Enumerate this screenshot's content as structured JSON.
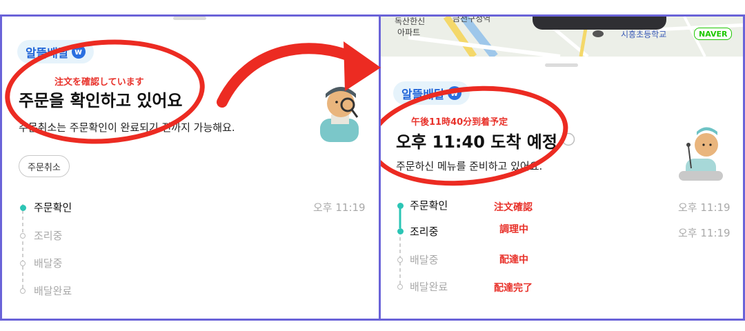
{
  "left": {
    "badge_text": "알뜰배달",
    "badge_icon": "w-icon",
    "jp_annotation": "注文を確認しています",
    "title": "주문을 확인하고 있어요",
    "subtitle": "주문취소는 주문확인이 완료되기 전까지 가능해요.",
    "cancel_button": "주문취소",
    "timeline": [
      {
        "label": "주문확인",
        "time": "오후 11:19",
        "state": "done"
      },
      {
        "label": "조리중",
        "time": "",
        "state": "pending"
      },
      {
        "label": "배달중",
        "time": "",
        "state": "pending"
      },
      {
        "label": "배달완료",
        "time": "",
        "state": "pending"
      }
    ]
  },
  "right": {
    "map": {
      "labels": [
        "독산한신",
        "아파트",
        "금천구청역",
        "시흥초등학교"
      ],
      "naver": "NAVER"
    },
    "badge_text": "알뜰배달",
    "jp_annotation": "午後11時40分到着予定",
    "title": "오후 11:40 도착 예정",
    "subtitle": "주문하신 메뉴를 준비하고 있어요.",
    "timeline": [
      {
        "label": "주문확인",
        "time": "오후 11:19",
        "note": "注文確認",
        "state": "done"
      },
      {
        "label": "조리중",
        "time": "오후 11:19",
        "note": "調理中",
        "state": "done"
      },
      {
        "label": "배달중",
        "time": "",
        "note": "配達中",
        "state": "pending"
      },
      {
        "label": "배달완료",
        "time": "",
        "note": "配達完了",
        "state": "pending"
      }
    ]
  },
  "colors": {
    "frame": "#6a63d8",
    "annotation_red": "#e8322b",
    "progress_teal": "#2cc5b5",
    "badge_blue": "#2467d8"
  }
}
